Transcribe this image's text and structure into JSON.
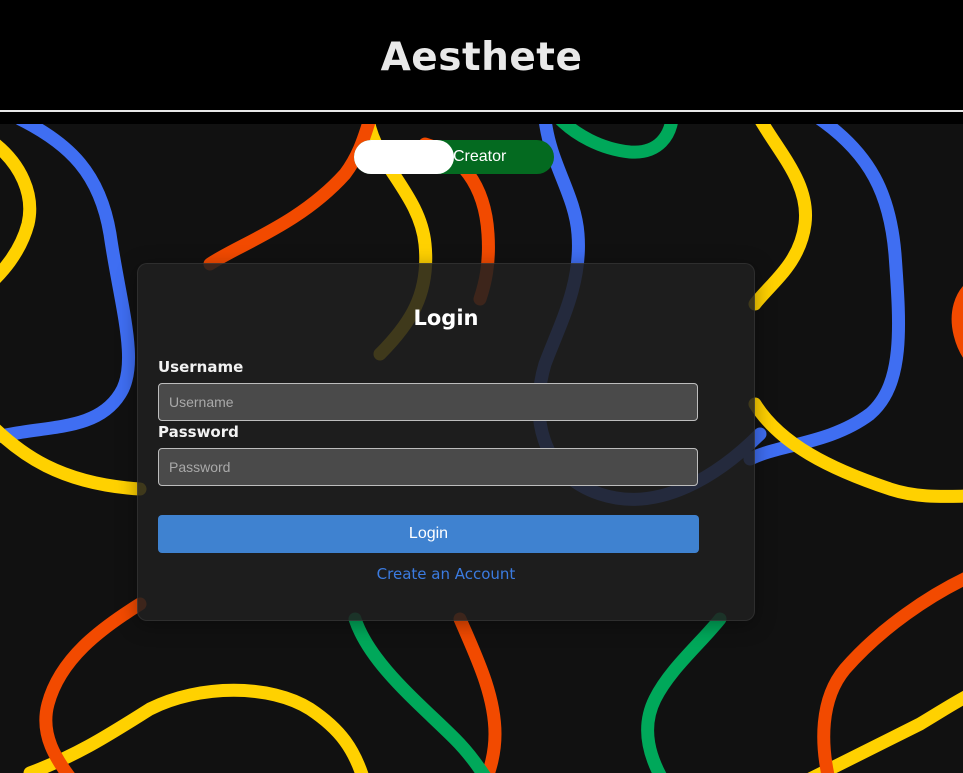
{
  "header": {
    "brand": "Aesthete"
  },
  "role_toggle": {
    "label": "Creator",
    "active_color": "#046a20"
  },
  "login_form": {
    "title": "Login",
    "username": {
      "label": "Username",
      "placeholder": "Username",
      "value": ""
    },
    "password": {
      "label": "Password",
      "placeholder": "Password",
      "value": ""
    },
    "submit_label": "Login",
    "create_account_link": "Create an Account"
  },
  "colors": {
    "header_bg": "#000000",
    "page_bg": "#111111",
    "button": "#3f82d0",
    "link": "#3b7be0",
    "squiggle_yellow": "#ffd100",
    "squiggle_blue": "#3f6ef2",
    "squiggle_orange": "#f24a00",
    "squiggle_green": "#00a85a"
  }
}
